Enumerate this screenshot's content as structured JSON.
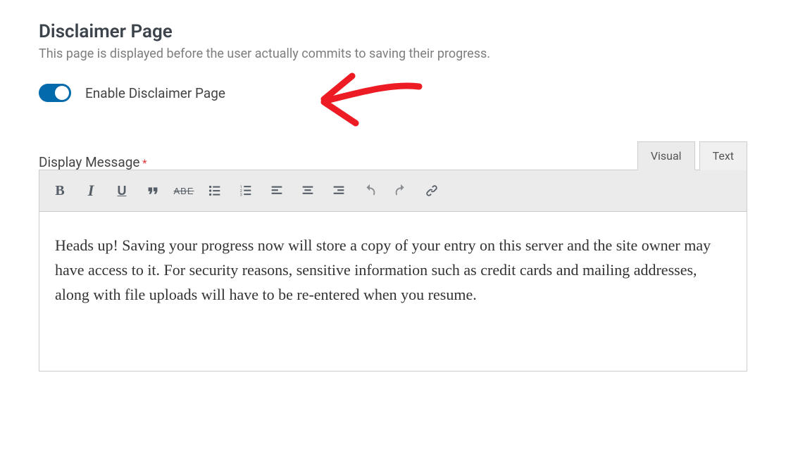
{
  "heading": "Disclaimer Page",
  "subtext": "This page is displayed before the user actually commits to saving their progress.",
  "toggle": {
    "enabled": true,
    "label": "Enable Disclaimer Page"
  },
  "field": {
    "label": "Display Message",
    "required_mark": "*"
  },
  "editor": {
    "tabs": {
      "visual": "Visual",
      "text": "Text",
      "active": "visual"
    },
    "toolbar": {
      "bold": "B",
      "italic": "I",
      "underline": "U",
      "strike": "ABE"
    },
    "content": "Heads up! Saving your progress now will store a copy of your entry on this server and the site owner may have access to it. For security reasons, sensitive information such as credit cards and mailing addresses, along with file uploads will have to be re-entered when you resume."
  },
  "annotation": {
    "color": "#ed1c24"
  }
}
